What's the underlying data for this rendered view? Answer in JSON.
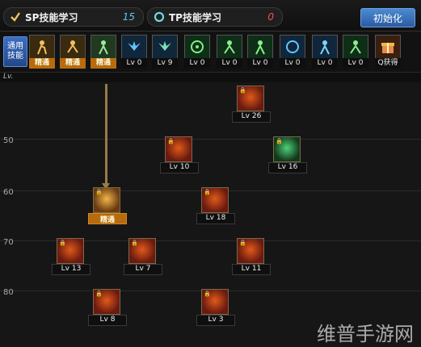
{
  "header": {
    "sp_label": "SP技能学习",
    "sp_value": "15",
    "tp_label": "TP技能学习",
    "tp_value": "0",
    "init_button": "初始化"
  },
  "quickbar": {
    "label_line1": "通用",
    "label_line2": "技能",
    "slots": [
      {
        "tag": "精通",
        "type": "master",
        "icon": "figure-icon"
      },
      {
        "tag": "精通",
        "type": "master",
        "icon": "figure-icon"
      },
      {
        "tag": "精通",
        "type": "master",
        "icon": "figure-icon"
      },
      {
        "tag": "Lv 0",
        "type": "level",
        "icon": "wings-icon"
      },
      {
        "tag": "Lv 9",
        "type": "level",
        "icon": "wings-icon"
      },
      {
        "tag": "Lv 0",
        "type": "level",
        "icon": "target-icon"
      },
      {
        "tag": "Lv 0",
        "type": "level",
        "icon": "figure-icon"
      },
      {
        "tag": "Lv 0",
        "type": "level",
        "icon": "figure-icon"
      },
      {
        "tag": "Lv 0",
        "type": "level",
        "icon": "ring-icon"
      },
      {
        "tag": "Lv 0",
        "type": "level",
        "icon": "figure-icon"
      },
      {
        "tag": "Lv 0",
        "type": "level",
        "icon": "figure-icon"
      },
      {
        "tag": "Q获得",
        "type": "level",
        "icon": "gift-icon"
      }
    ]
  },
  "grid": {
    "lv_header": "Lv.",
    "rows": [
      "50",
      "60",
      "70",
      "80"
    ],
    "nodes": [
      {
        "id": "n1",
        "label": "Lv 26"
      },
      {
        "id": "n2",
        "label": "Lv 10"
      },
      {
        "id": "n3",
        "label": "Lv 16"
      },
      {
        "id": "n4",
        "label": "精通"
      },
      {
        "id": "n5",
        "label": "Lv 18"
      },
      {
        "id": "n6",
        "label": "Lv 13"
      },
      {
        "id": "n7",
        "label": "Lv 7"
      },
      {
        "id": "n8",
        "label": "Lv 11"
      },
      {
        "id": "n9",
        "label": "Lv 8"
      },
      {
        "id": "n10",
        "label": "Lv 3"
      }
    ]
  },
  "watermark": "维普手游网",
  "colors": {
    "sp_value": "#5ec8ff",
    "tp_value": "#ff4d4d",
    "master_tag": "#b86b0c",
    "init_button": "#2b5aa3"
  }
}
